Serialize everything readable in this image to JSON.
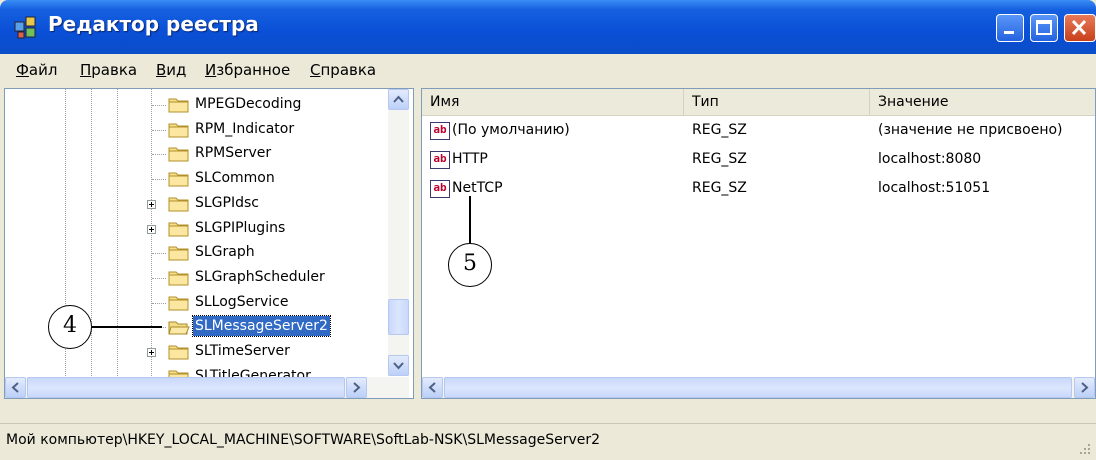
{
  "window": {
    "title": "Редактор реестра"
  },
  "menu": [
    {
      "prefix": "",
      "ul": "Ф",
      "rest": "айл"
    },
    {
      "prefix": "",
      "ul": "П",
      "rest": "равка"
    },
    {
      "prefix": "",
      "ul": "В",
      "rest": "ид"
    },
    {
      "prefix": "",
      "ul": "И",
      "rest": "збранное"
    },
    {
      "prefix": "",
      "ul": "С",
      "rest": "правка"
    }
  ],
  "tree": {
    "items": [
      {
        "label": "MPEGDecoding",
        "expandable": false,
        "selected": false
      },
      {
        "label": "RPM_Indicator",
        "expandable": false,
        "selected": false
      },
      {
        "label": "RPMServer",
        "expandable": false,
        "selected": false
      },
      {
        "label": "SLCommon",
        "expandable": false,
        "selected": false
      },
      {
        "label": "SLGPIdsc",
        "expandable": true,
        "selected": false
      },
      {
        "label": "SLGPIPlugins",
        "expandable": true,
        "selected": false
      },
      {
        "label": "SLGraph",
        "expandable": false,
        "selected": false
      },
      {
        "label": "SLGraphScheduler",
        "expandable": false,
        "selected": false
      },
      {
        "label": "SLLogService",
        "expandable": false,
        "selected": false
      },
      {
        "label": "SLMessageServer2",
        "expandable": false,
        "selected": true
      },
      {
        "label": "SLTimeServer",
        "expandable": true,
        "selected": false
      },
      {
        "label": "SLTitleGenerator",
        "expandable": false,
        "selected": false
      }
    ]
  },
  "list": {
    "columns": [
      "Имя",
      "Тип",
      "Значение"
    ],
    "rows": [
      {
        "icon": "string-value-icon",
        "icon_text": "ab",
        "name": "(По умолчанию)",
        "type": "REG_SZ",
        "value": "(значение не присвоено)"
      },
      {
        "icon": "string-value-icon",
        "icon_text": "ab",
        "name": "HTTP",
        "type": "REG_SZ",
        "value": "localhost:8080"
      },
      {
        "icon": "string-value-icon",
        "icon_text": "ab",
        "name": "NetTCP",
        "type": "REG_SZ",
        "value": "localhost:51051"
      }
    ]
  },
  "status": {
    "path": "Мой компьютер\\HKEY_LOCAL_MACHINE\\SOFTWARE\\SoftLab-NSK\\SLMessageServer2"
  },
  "callouts": {
    "tree": "4",
    "list": "5"
  },
  "colors": {
    "titlebar": "#0a4fd6",
    "selection": "#316ac5",
    "close_button": "#c8401a"
  }
}
